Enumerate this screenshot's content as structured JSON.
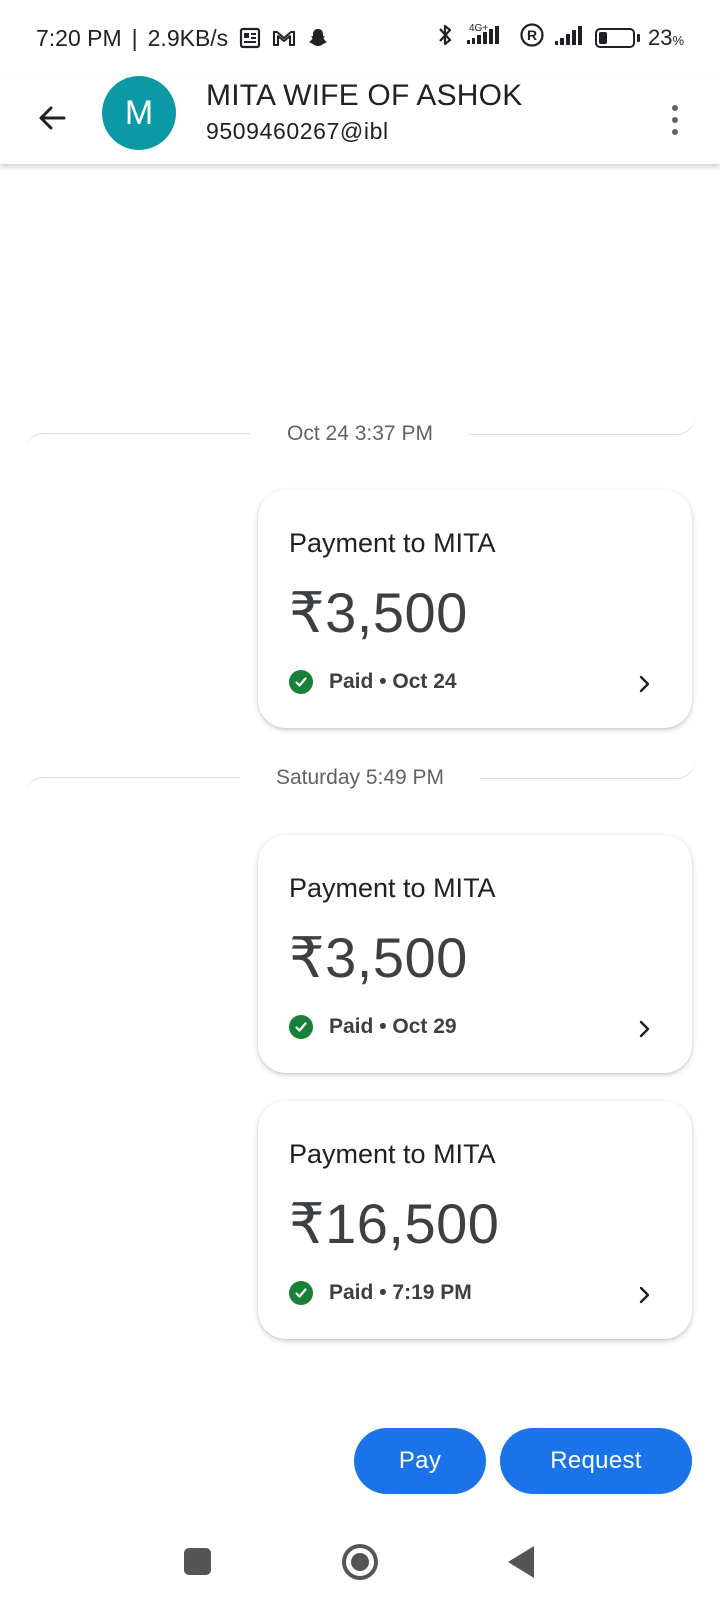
{
  "status_bar": {
    "time": "7:20 PM",
    "separator": "|",
    "net_speed": "2.9KB/s",
    "network_label": "4G+",
    "battery_percent": "23",
    "battery_unit": "%",
    "battery_level": 0.23,
    "icons": [
      "news-icon",
      "gmail-icon",
      "snapchat-icon",
      "bluetooth-icon",
      "signal-4g-icon",
      "roaming-r-icon",
      "signal-icon",
      "battery-icon"
    ]
  },
  "header": {
    "avatar_letter": "M",
    "avatar_color": "#0b9aa5",
    "contact_name": "MITA WIFE OF ASHOK",
    "upi_id": "9509460267@ibl"
  },
  "timeline": [
    {
      "date_label": "Oct 24 3:37 PM",
      "cards": [
        {
          "title": "Payment to MITA",
          "amount": "₹3,500",
          "status": "Paid",
          "dot": "•",
          "date": "Oct 24"
        }
      ]
    },
    {
      "date_label": "Saturday 5:49 PM",
      "cards": [
        {
          "title": "Payment to MITA",
          "amount": "₹3,500",
          "status": "Paid",
          "dot": "•",
          "date": "Oct 29"
        },
        {
          "title": "Payment to MITA",
          "amount": "₹16,500",
          "status": "Paid",
          "dot": "•",
          "date": "7:19 PM"
        }
      ]
    }
  ],
  "actions": {
    "pay_label": "Pay",
    "request_label": "Request",
    "accent_color": "#1a73e8"
  },
  "status_color_paid": "#188038"
}
